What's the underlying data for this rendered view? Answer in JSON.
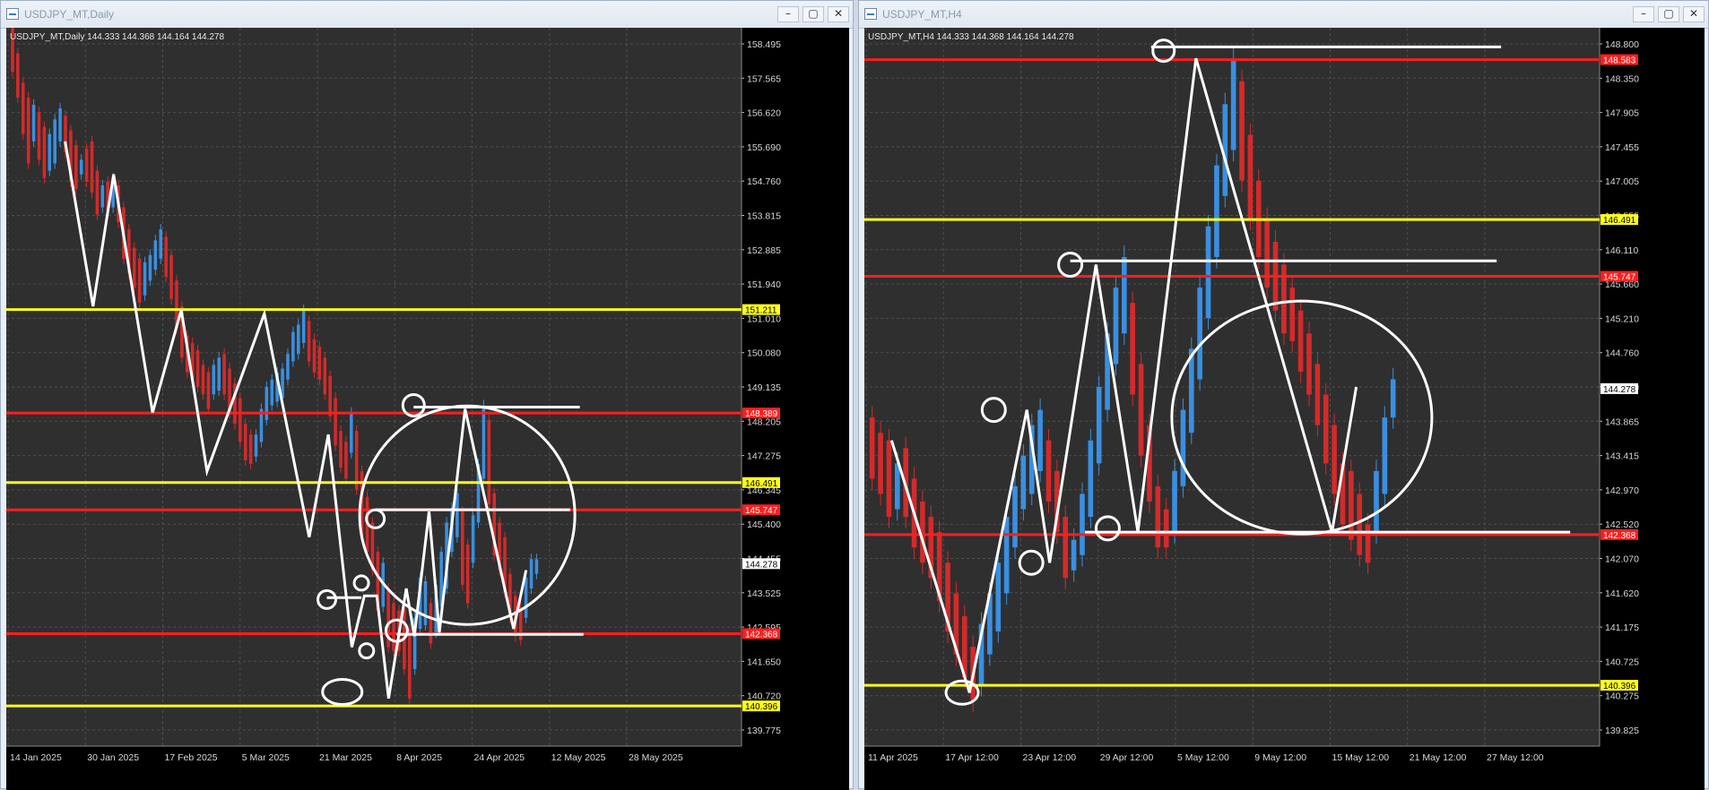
{
  "colors": {
    "background": "#000000",
    "plot_background": "#2f2f2f",
    "grid": "#4f4f4f",
    "bull": "#3a8fe0",
    "bear": "#d42a2a",
    "support_resistance_red": "#ff1e1e",
    "support_resistance_yellow": "#ffff1e",
    "drawing": "#ffffff"
  },
  "windows": [
    {
      "title": "USDJPY_MT,Daily",
      "chart_header": "USDJPY_MT,Daily  144.333 144.368 144.164 144.278",
      "chart_data": {
        "type": "candlestick",
        "symbol": "USDJPY_MT",
        "timeframe": "Daily",
        "ohlc": {
          "open": 144.333,
          "high": 144.368,
          "low": 144.164,
          "close": 144.278
        },
        "ylim": [
          139.3,
          158.9
        ],
        "y_ticks": [
          "158.495",
          "157.565",
          "156.620",
          "155.690",
          "154.760",
          "153.815",
          "152.885",
          "151.940",
          "151.010",
          "150.080",
          "149.135",
          "148.205",
          "147.275",
          "146.345",
          "145.400",
          "144.455",
          "143.525",
          "142.595",
          "141.650",
          "140.720",
          "139.775"
        ],
        "x_labels": [
          "14 Jan 2025",
          "30 Jan 2025",
          "17 Feb 2025",
          "5 Mar 2025",
          "21 Mar 2025",
          "8 Apr 2025",
          "24 Apr 2025",
          "12 May 2025",
          "28 May 2025"
        ],
        "current_price_label": "144.278",
        "current_price": 144.278,
        "levels": [
          {
            "price": 151.211,
            "color": "yellow",
            "label": "151.211"
          },
          {
            "price": 148.389,
            "color": "red",
            "label": "148.389"
          },
          {
            "price": 146.491,
            "color": "yellow",
            "label": "146.491"
          },
          {
            "price": 145.747,
            "color": "red",
            "label": "145.747"
          },
          {
            "price": 142.368,
            "color": "red",
            "label": "142.368"
          },
          {
            "price": 140.396,
            "color": "yellow",
            "label": "140.396"
          }
        ],
        "zigzag": [
          [
            0.08,
            155.8
          ],
          [
            0.118,
            151.3
          ],
          [
            0.146,
            154.9
          ],
          [
            0.199,
            148.4
          ],
          [
            0.238,
            151.2
          ],
          [
            0.273,
            146.8
          ],
          [
            0.351,
            151.1
          ],
          [
            0.412,
            145.0
          ],
          [
            0.438,
            147.8
          ],
          [
            0.47,
            142.0
          ],
          [
            0.487,
            143.4
          ],
          [
            0.504,
            143.4
          ],
          [
            0.52,
            140.6
          ],
          [
            0.544,
            143.6
          ],
          [
            0.555,
            142.3
          ],
          [
            0.575,
            145.7
          ],
          [
            0.589,
            142.4
          ],
          [
            0.624,
            148.5
          ],
          [
            0.69,
            142.5
          ],
          [
            0.707,
            144.1
          ]
        ],
        "candles": [
          [
            159.0,
            157.7
          ],
          [
            158.2,
            157.0
          ],
          [
            157.4,
            156.0
          ],
          [
            157.0,
            155.2
          ],
          [
            156.8,
            155.8
          ],
          [
            156.6,
            155.3
          ],
          [
            156.2,
            154.8
          ],
          [
            156.0,
            155.0
          ],
          [
            156.4,
            155.2
          ],
          [
            156.7,
            155.8
          ],
          [
            156.5,
            155.5
          ],
          [
            156.1,
            154.7
          ],
          [
            155.7,
            154.5
          ],
          [
            155.3,
            154.9
          ],
          [
            155.6,
            154.7
          ],
          [
            155.8,
            154.4
          ],
          [
            155.0,
            153.8
          ],
          [
            154.6,
            154.0
          ],
          [
            154.7,
            153.9
          ],
          [
            154.8,
            154.0
          ],
          [
            154.6,
            153.6
          ],
          [
            154.0,
            152.6
          ],
          [
            153.4,
            152.2
          ],
          [
            152.9,
            151.8
          ],
          [
            152.6,
            151.4
          ],
          [
            152.5,
            151.6
          ],
          [
            152.7,
            152.0
          ],
          [
            153.1,
            152.3
          ],
          [
            153.4,
            152.6
          ],
          [
            153.2,
            152.1
          ],
          [
            152.7,
            151.5
          ],
          [
            152.0,
            150.7
          ],
          [
            151.3,
            149.9
          ],
          [
            150.5,
            149.5
          ],
          [
            150.3,
            149.3
          ],
          [
            150.1,
            149.1
          ],
          [
            149.7,
            148.9
          ],
          [
            149.5,
            148.5
          ],
          [
            149.7,
            148.9
          ],
          [
            149.9,
            149.0
          ],
          [
            150.0,
            148.9
          ],
          [
            149.6,
            148.4
          ],
          [
            149.2,
            148.1
          ],
          [
            148.8,
            147.6
          ],
          [
            148.1,
            147.1
          ],
          [
            147.8,
            147.0
          ],
          [
            147.8,
            147.2
          ],
          [
            148.5,
            147.6
          ],
          [
            149.1,
            148.2
          ],
          [
            149.3,
            148.6
          ],
          [
            149.5,
            148.7
          ],
          [
            149.6,
            148.8
          ],
          [
            150.0,
            149.3
          ],
          [
            150.6,
            149.8
          ],
          [
            150.8,
            150.0
          ],
          [
            151.2,
            150.3
          ],
          [
            150.9,
            149.8
          ],
          [
            150.4,
            149.5
          ],
          [
            150.2,
            149.3
          ],
          [
            149.9,
            148.9
          ],
          [
            149.4,
            148.3
          ],
          [
            148.8,
            147.5
          ],
          [
            147.9,
            146.9
          ],
          [
            147.6,
            146.6
          ],
          [
            148.4,
            147.3
          ],
          [
            147.9,
            146.3
          ],
          [
            146.8,
            145.0
          ],
          [
            146.1,
            144.6
          ],
          [
            145.4,
            144.1
          ],
          [
            144.6,
            143.0
          ],
          [
            144.3,
            143.1
          ],
          [
            143.6,
            142.0
          ],
          [
            143.2,
            141.9
          ],
          [
            143.0,
            141.9
          ],
          [
            143.1,
            141.4
          ],
          [
            142.5,
            140.6
          ],
          [
            142.8,
            141.4
          ],
          [
            143.9,
            142.5
          ],
          [
            143.8,
            142.6
          ],
          [
            143.2,
            142.1
          ],
          [
            143.7,
            142.4
          ],
          [
            144.6,
            143.1
          ],
          [
            145.4,
            143.6
          ],
          [
            145.8,
            144.6
          ],
          [
            146.2,
            145.0
          ],
          [
            145.7,
            143.7
          ],
          [
            144.8,
            143.2
          ],
          [
            145.6,
            144.3
          ],
          [
            147.0,
            145.4
          ],
          [
            148.6,
            146.6
          ],
          [
            148.2,
            145.9
          ],
          [
            146.2,
            144.5
          ],
          [
            145.4,
            144.1
          ],
          [
            145.0,
            143.5
          ],
          [
            144.0,
            142.8
          ],
          [
            143.4,
            142.3
          ],
          [
            143.1,
            142.2
          ],
          [
            143.9,
            142.8
          ],
          [
            144.4,
            143.6
          ],
          [
            144.4,
            144.0
          ]
        ]
      }
    },
    {
      "title": "USDJPY_MT,H4",
      "chart_header": "USDJPY_MT,H4  144.333 144.368 144.164 144.278",
      "chart_data": {
        "type": "candlestick",
        "symbol": "USDJPY_MT",
        "timeframe": "H4",
        "ohlc": {
          "open": 144.333,
          "high": 144.368,
          "low": 144.164,
          "close": 144.278
        },
        "ylim": [
          139.6,
          149.0
        ],
        "y_ticks": [
          "148.800",
          "148.350",
          "147.905",
          "147.455",
          "147.005",
          "146.555",
          "146.110",
          "145.660",
          "145.210",
          "144.760",
          "144.310",
          "143.865",
          "143.415",
          "142.970",
          "142.520",
          "142.070",
          "141.620",
          "141.175",
          "140.725",
          "140.275",
          "139.825"
        ],
        "x_labels": [
          "11 Apr 2025",
          "17 Apr 12:00",
          "23 Apr 12:00",
          "29 Apr 12:00",
          "5 May 12:00",
          "9 May 12:00",
          "15 May 12:00",
          "21 May 12:00",
          "27 May 12:00"
        ],
        "current_price_label": "144.278",
        "current_price": 144.278,
        "levels": [
          {
            "price": 148.583,
            "color": "red",
            "label": "148.583"
          },
          {
            "price": 146.491,
            "color": "yellow",
            "label": "146.491"
          },
          {
            "price": 145.747,
            "color": "red",
            "label": "145.747"
          },
          {
            "price": 142.368,
            "color": "red",
            "label": "142.368"
          },
          {
            "price": 140.396,
            "color": "yellow",
            "label": "140.396"
          }
        ],
        "zigzag": [
          [
            0.037,
            143.6
          ],
          [
            0.143,
            140.3
          ],
          [
            0.221,
            144.0
          ],
          [
            0.252,
            142.0
          ],
          [
            0.315,
            145.9
          ],
          [
            0.372,
            142.4
          ],
          [
            0.451,
            148.6
          ],
          [
            0.636,
            142.4
          ],
          [
            0.669,
            144.3
          ]
        ],
        "candles": [
          [
            143.9,
            143.1
          ],
          [
            143.7,
            142.9
          ],
          [
            143.6,
            142.6
          ],
          [
            143.3,
            142.7
          ],
          [
            143.5,
            142.6
          ],
          [
            143.1,
            142.2
          ],
          [
            142.8,
            142.0
          ],
          [
            142.6,
            141.8
          ],
          [
            142.4,
            141.5
          ],
          [
            142.0,
            141.1
          ],
          [
            141.6,
            140.8
          ],
          [
            141.3,
            140.5
          ],
          [
            140.9,
            140.2
          ],
          [
            141.2,
            140.4
          ],
          [
            141.6,
            140.8
          ],
          [
            142.0,
            141.1
          ],
          [
            142.6,
            141.6
          ],
          [
            143.0,
            142.2
          ],
          [
            143.4,
            142.7
          ],
          [
            143.8,
            142.9
          ],
          [
            144.0,
            143.2
          ],
          [
            143.6,
            142.8
          ],
          [
            143.2,
            142.4
          ],
          [
            142.6,
            141.8
          ],
          [
            142.3,
            141.9
          ],
          [
            142.9,
            142.1
          ],
          [
            143.6,
            142.6
          ],
          [
            144.3,
            143.3
          ],
          [
            145.0,
            144.0
          ],
          [
            145.6,
            144.6
          ],
          [
            146.0,
            145.0
          ],
          [
            145.4,
            144.2
          ],
          [
            144.6,
            143.4
          ],
          [
            143.8,
            142.8
          ],
          [
            143.0,
            142.2
          ],
          [
            142.7,
            142.2
          ],
          [
            143.2,
            142.4
          ],
          [
            144.0,
            143.0
          ],
          [
            144.8,
            143.7
          ],
          [
            145.6,
            144.4
          ],
          [
            146.4,
            145.2
          ],
          [
            147.2,
            146.0
          ],
          [
            148.0,
            146.8
          ],
          [
            148.6,
            147.4
          ],
          [
            148.3,
            147.0
          ],
          [
            147.6,
            146.5
          ],
          [
            147.0,
            146.0
          ],
          [
            146.5,
            145.6
          ],
          [
            146.2,
            145.3
          ],
          [
            145.9,
            145.0
          ],
          [
            145.6,
            144.9
          ],
          [
            145.3,
            144.5
          ],
          [
            145.0,
            144.2
          ],
          [
            144.6,
            143.8
          ],
          [
            144.2,
            143.3
          ],
          [
            143.8,
            142.9
          ],
          [
            143.3,
            142.5
          ],
          [
            143.2,
            142.3
          ],
          [
            142.9,
            142.1
          ],
          [
            142.5,
            142.0
          ],
          [
            143.2,
            142.4
          ],
          [
            143.9,
            142.9
          ],
          [
            144.4,
            143.9
          ]
        ]
      }
    }
  ]
}
